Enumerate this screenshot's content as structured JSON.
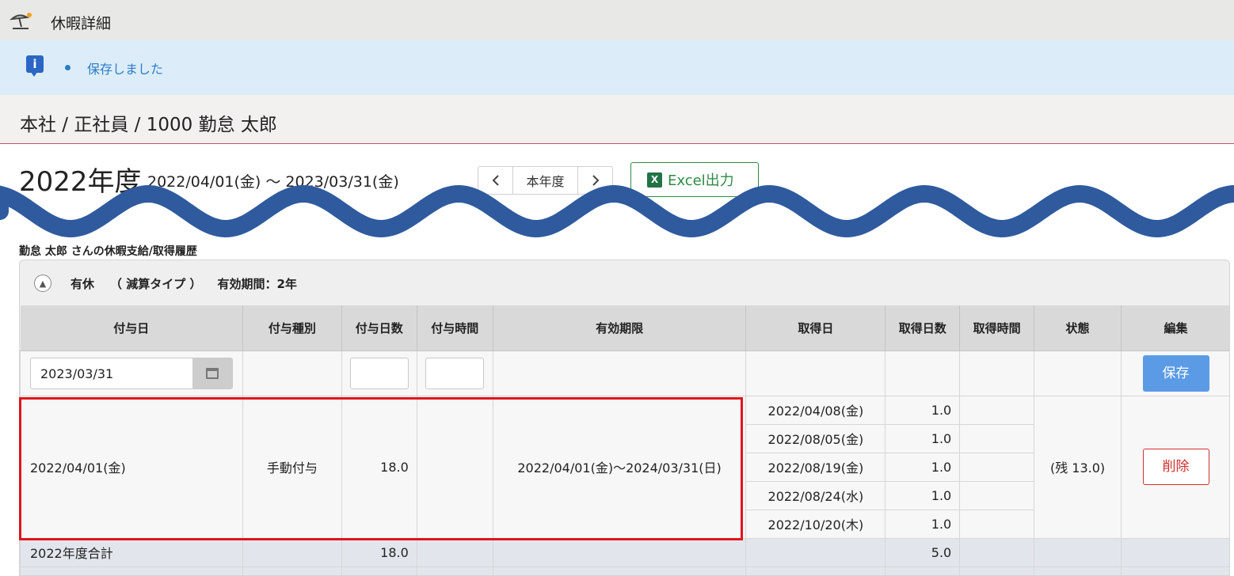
{
  "header": {
    "title": "休暇詳細",
    "icon": "beach-umbrella-icon"
  },
  "notice": {
    "message": "保存しました",
    "icon": "info-icon"
  },
  "breadcrumb": {
    "text": "本社 / 正社員 / 1000 勤怠 太郎"
  },
  "period": {
    "year_label": "2022年度",
    "range": "2022/04/01(金) ～ 2023/03/31(金)",
    "nav_prev": "<",
    "nav_current": "本年度",
    "nav_next": ">",
    "excel_label": "Excel出力"
  },
  "history": {
    "title": "勤怠 太郎 さんの休暇支給/取得履歴",
    "panel": {
      "type": "有休",
      "subtype": "（ 減算タイプ ）",
      "validity": "有効期間：2年"
    },
    "columns": [
      "付与日",
      "付与種別",
      "付与日数",
      "付与時間",
      "有効期限",
      "取得日",
      "取得日数",
      "取得時間",
      "状態",
      "編集"
    ],
    "input_row": {
      "grant_date": "2023/03/31",
      "save_label": "保存"
    },
    "grant": {
      "grant_date": "2022/04/01(金)",
      "grant_type": "手動付与",
      "grant_days": "18.0",
      "expiry": "2022/04/01(金)～2024/03/31(日)",
      "status": "(残 13.0)",
      "delete_label": "削除",
      "usages": [
        {
          "date": "2022/04/08(金)",
          "days": "1.0"
        },
        {
          "date": "2022/08/05(金)",
          "days": "1.0"
        },
        {
          "date": "2022/08/19(金)",
          "days": "1.0"
        },
        {
          "date": "2022/08/24(水)",
          "days": "1.0"
        },
        {
          "date": "2022/10/20(木)",
          "days": "1.0"
        }
      ]
    },
    "total": {
      "label": "2022年度合計",
      "grant_days": "18.0",
      "used_days": "5.0"
    }
  },
  "colors": {
    "highlight": "#e0151c",
    "wave": "#2f5a9e",
    "accent": "#5b9be6",
    "danger": "#d0312d"
  }
}
